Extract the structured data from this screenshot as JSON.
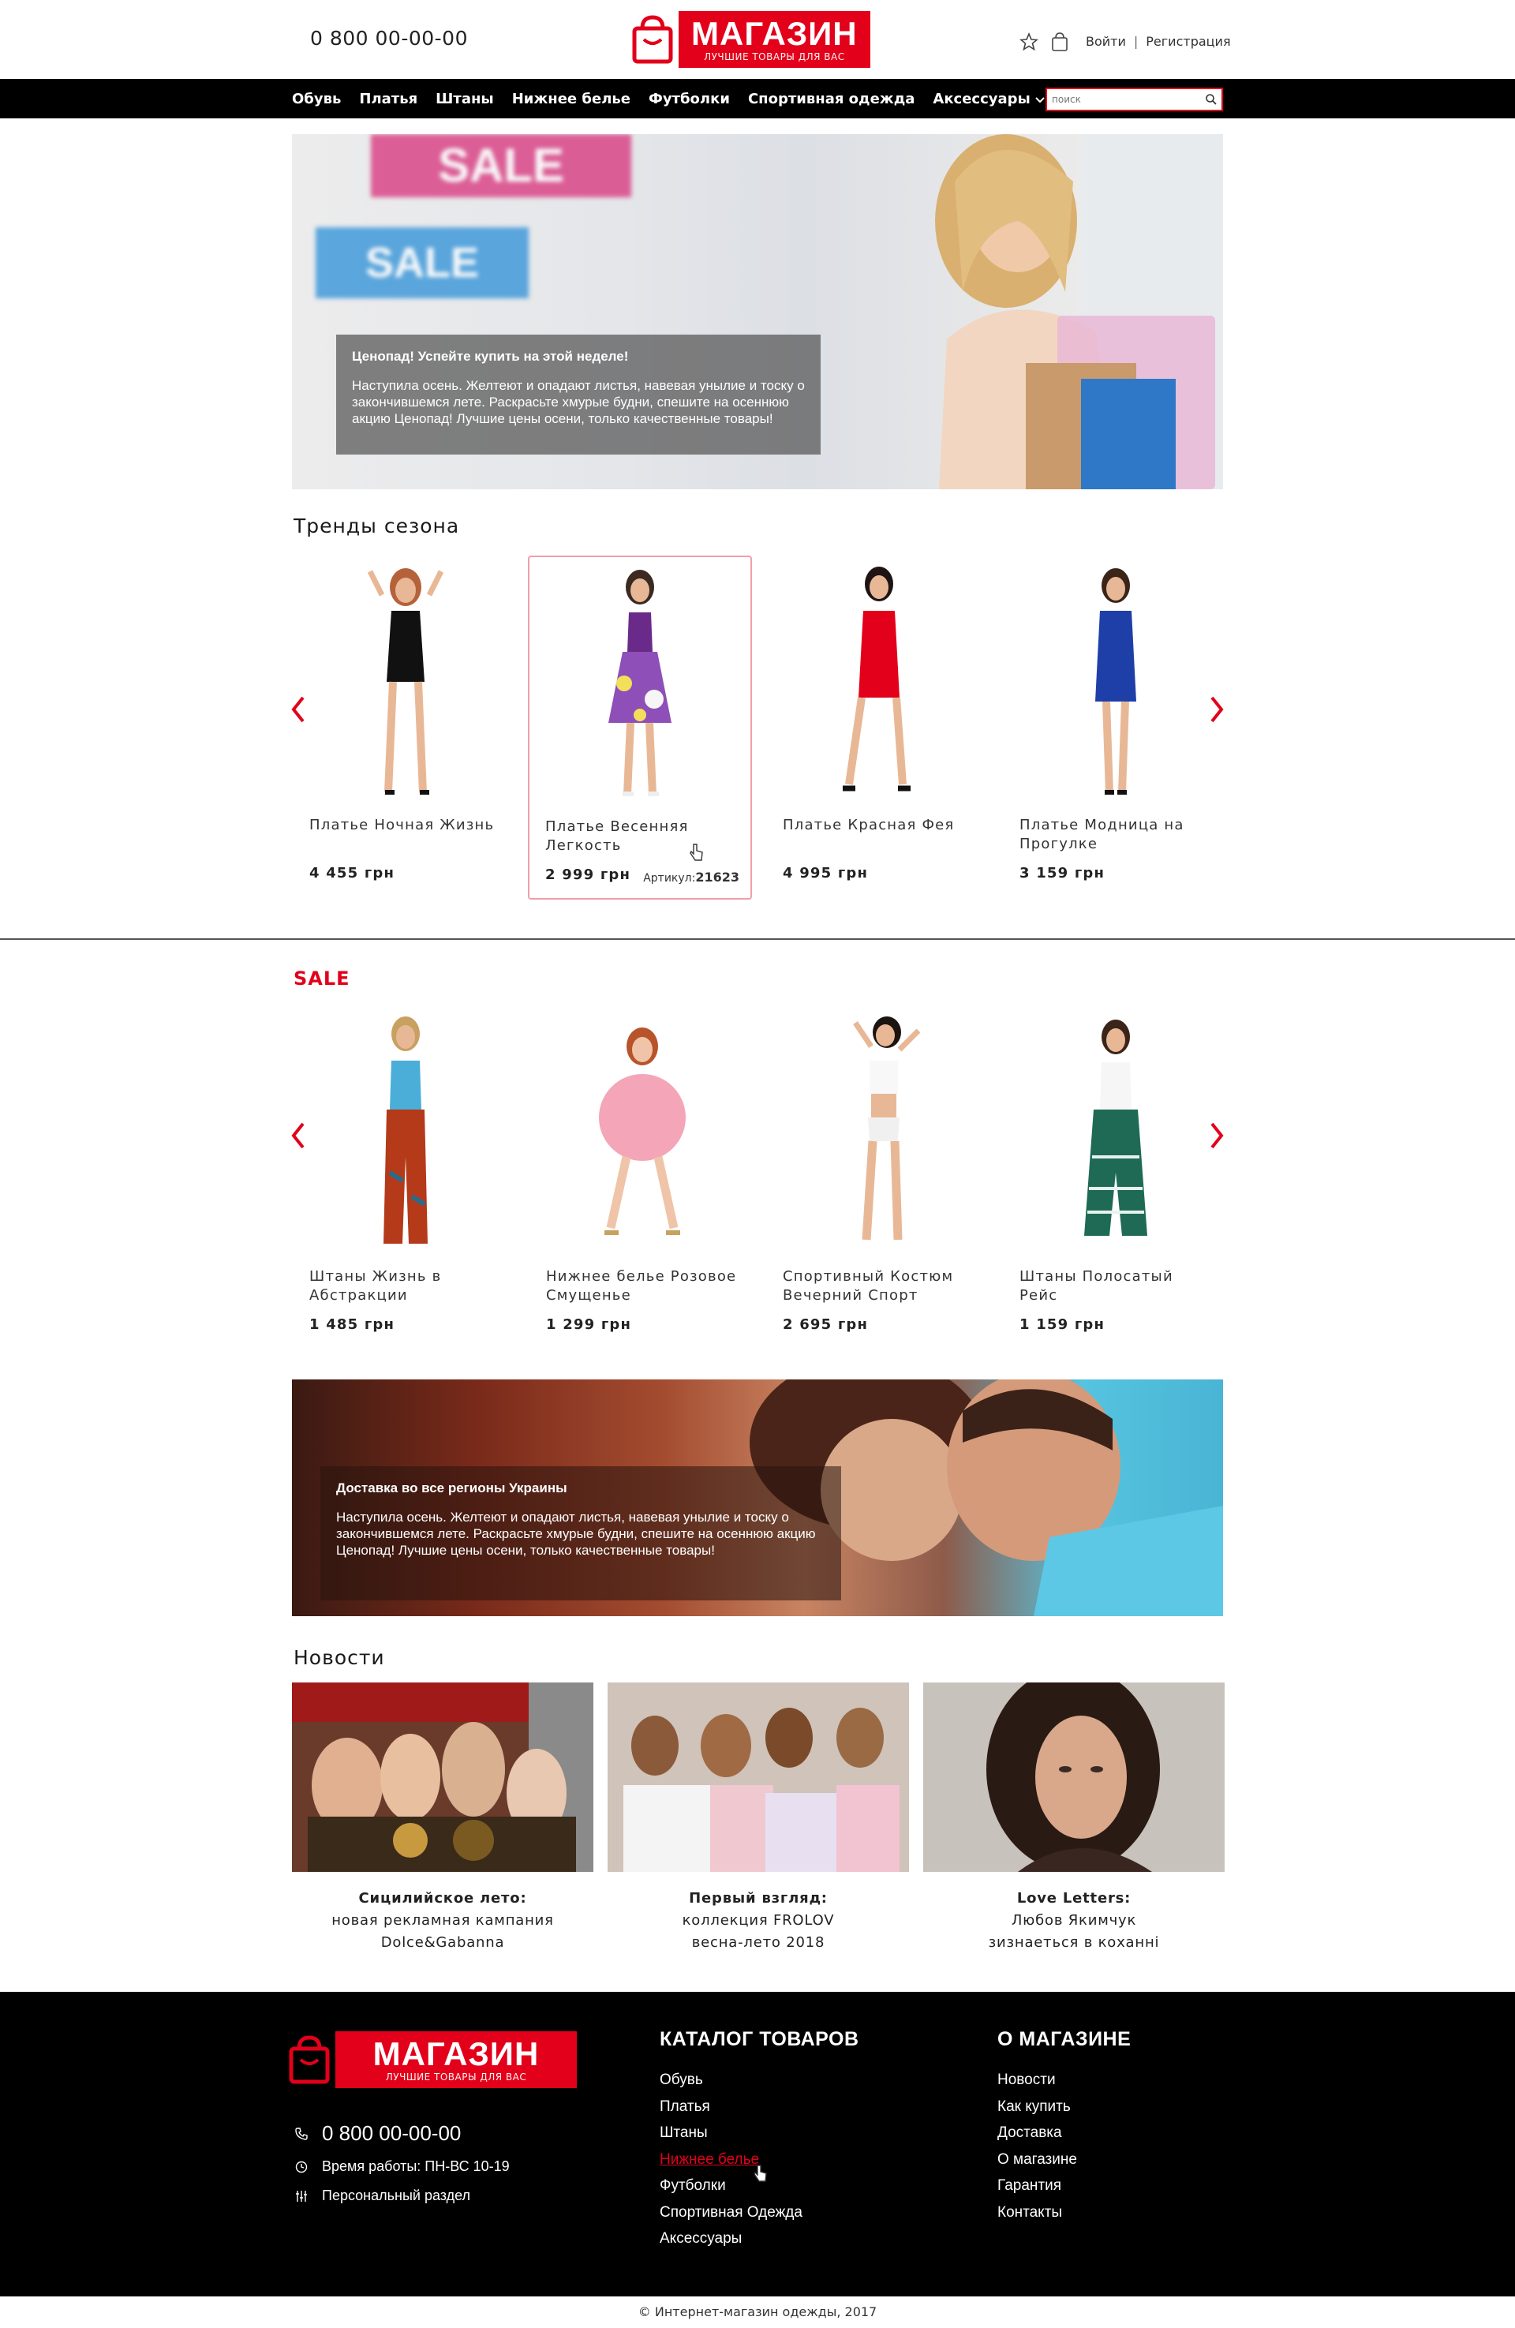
{
  "header": {
    "phone": "0 800 00-00-00",
    "logo_title": "МАГАЗИН",
    "logo_subtitle": "ЛУЧШИЕ ТОВАРЫ ДЛЯ ВАС",
    "login": "Войти",
    "separator": "|",
    "register": "Регистрация"
  },
  "nav": {
    "items": [
      "Обувь",
      "Платья",
      "Штаны",
      "Нижнее белье",
      "Футболки",
      "Спортивная одежда",
      "Аксессуары"
    ],
    "search_placeholder": "поиск"
  },
  "banner1": {
    "title": "Ценопад! Успейте купить на этой неделе!",
    "text": "Наступила осень. Желтеют и опадают листья, навевая унылие и тоску о закончившемся лете. Раскрасьте хмурые будни, спешите на осеннюю акцию Ценопад! Лучшие цены осени, только качественные товары!",
    "sign1": "SALE",
    "sign2": "SALE"
  },
  "trends": {
    "title": "Тренды сезона",
    "products": [
      {
        "name": "Платье Ночная Жизнь",
        "price": "4 455 грн"
      },
      {
        "name": "Платье Весенняя Легкость",
        "price": "2 999 грн",
        "article_label": "Артикул:",
        "article": "21623"
      },
      {
        "name": "Платье Красная Фея",
        "price": "4 995 грн"
      },
      {
        "name": "Платье Модница на Прогулке",
        "price": "3 159 грн"
      }
    ]
  },
  "sale": {
    "title": "SALE",
    "products": [
      {
        "name": "Штаны Жизнь в Абстракции",
        "price": "1 485 грн"
      },
      {
        "name": "Нижнее белье Розовое Смущенье",
        "price": "1 299 грн"
      },
      {
        "name": "Спортивный Костюм Вечерний Спорт",
        "price": "2 695 грн"
      },
      {
        "name": "Штаны Полосатый Рейс",
        "price": "1 159 грн"
      }
    ]
  },
  "banner2": {
    "title": "Доставка во все регионы Украины",
    "text": "Наступила осень. Желтеют и опадают листья, навевая унылие и тоску о закончившемся лете. Раскрасьте хмурые будни, спешите на осеннюю акцию Ценопад! Лучшие цены осени, только качественные товары!"
  },
  "news": {
    "title": "Новости",
    "items": [
      {
        "title": "Сицилийское лето:",
        "line1": "новая рекламная кампания",
        "line2": "Dolce&Gabanna"
      },
      {
        "title": "Первый взгляд:",
        "line1": "коллекция FROLOV",
        "line2": "весна-лето 2018"
      },
      {
        "title": "Love Letters:",
        "line1": "Любов Якимчук",
        "line2": "зизнаеться в коханні"
      }
    ]
  },
  "footer": {
    "phone": "0 800 00-00-00",
    "hours": "Время работы: ПН-ВС 10-19",
    "personal": "Персональный раздел",
    "catalog_title": "КАТАЛОГ ТОВАРОВ",
    "catalog": [
      "Обувь",
      "Платья",
      "Штаны",
      "Нижнее белье",
      "Футболки",
      "Спортивная Одежда",
      "Аксессуары"
    ],
    "about_title": "О МАГАЗИНЕ",
    "about": [
      "Новости",
      "Как купить",
      "Доставка",
      "О магазине",
      "Гарантия",
      "Контакты"
    ],
    "copyright": "© Интернет-магазин одежды, 2017"
  },
  "colors": {
    "accent": "#e2001a",
    "nav_bg": "#000000",
    "footer_bg": "#000000"
  },
  "icons": [
    "star-icon",
    "cart-icon",
    "search-icon",
    "chevron-left-icon",
    "chevron-right-icon",
    "phone-icon",
    "clock-icon",
    "user-icon",
    "shopping-bag-icon",
    "cursor-hand-icon"
  ]
}
